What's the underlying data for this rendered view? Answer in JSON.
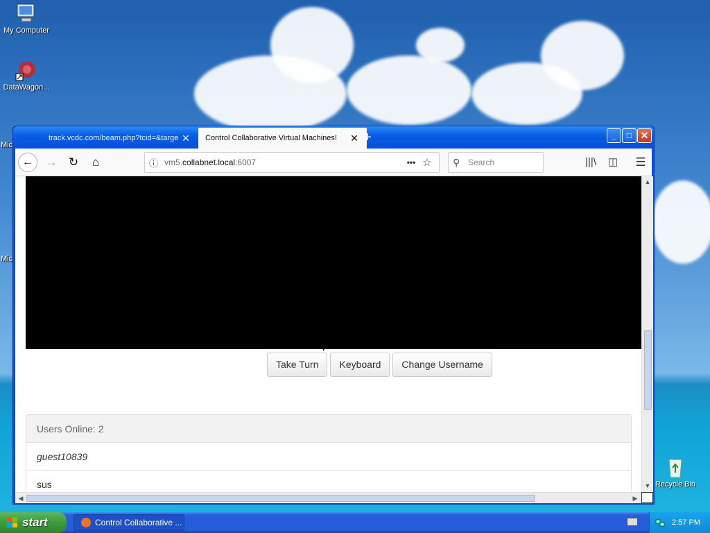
{
  "desktop": {
    "icons": [
      {
        "label": "My Computer"
      },
      {
        "label": "DataWagon..."
      },
      {
        "label": "Recycle Bin"
      }
    ],
    "clipped_labels": [
      "Mic",
      "Mic"
    ]
  },
  "browser": {
    "tabs": [
      {
        "label": "track.vcdc.com/beam.php?tcid=&targe",
        "active": false
      },
      {
        "label": "Control Collaborative Virtual Machines!",
        "active": true
      }
    ],
    "window_controls": {
      "min": "_",
      "max": "□",
      "close": "✕"
    },
    "url": {
      "prefix": "vm5.",
      "host": "collabnet.local",
      "suffix": ":6007"
    },
    "search_placeholder": "Search"
  },
  "page": {
    "buttons": {
      "take_turn": "Take Turn",
      "keyboard": "Keyboard",
      "change_username": "Change Username"
    },
    "users_panel": {
      "heading": "Users Online: 2",
      "users": [
        "guest10839",
        "sus"
      ]
    }
  },
  "taskbar": {
    "start_label": "start",
    "task_item": "Control Collaborative ...",
    "clock": "2:57 PM"
  },
  "colors": {
    "titlebar": "#0a5ee6",
    "start_green": "#3c9a3c",
    "taskbar_blue": "#245edb"
  }
}
